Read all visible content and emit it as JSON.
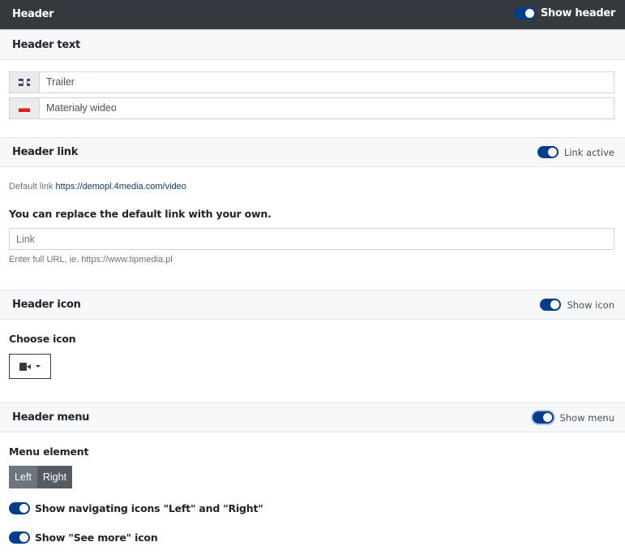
{
  "header": {
    "title": "Header",
    "toggle_label": "Show header",
    "toggle_on": true
  },
  "header_text": {
    "title": "Header text",
    "languages": [
      {
        "flag": "flag-uk-icon",
        "value": "Trailer"
      },
      {
        "flag": "flag-pl-icon",
        "value": "Materiały wideo"
      }
    ]
  },
  "header_link": {
    "title": "Header link",
    "toggle_label": "Link active",
    "toggle_on": true,
    "default_link_label": "Default link",
    "default_link_url": "https://demopl.4media.com/video",
    "replace_label": "You can replace the default link with your own.",
    "link_input_value": "",
    "link_input_placeholder": "Link",
    "hint": "Enter full URL, ie. https://www.tipmedia.pl"
  },
  "header_icon": {
    "title": "Header icon",
    "toggle_label": "Show icon",
    "toggle_on": true,
    "choose_label": "Choose icon",
    "selected_icon": "video-camera-icon"
  },
  "header_menu": {
    "title": "Header menu",
    "toggle_label": "Show menu",
    "toggle_on": true,
    "menu_element_label": "Menu element",
    "buttons": [
      "Left",
      "Right"
    ],
    "selected_button": "Right",
    "nav_icons_label": "Show navigating icons \"Left\" and \"Right\"",
    "nav_icons_on": true,
    "see_more_label": "Show \"See more\" icon",
    "see_more_on": true
  },
  "colors": {
    "topbar_bg": "#343a40",
    "toggle_on": "#013d8b",
    "section_bg": "#f7f8fa",
    "link_color": "#0b3a75",
    "btn_left": "#6c757d",
    "btn_right": "#545b62"
  }
}
